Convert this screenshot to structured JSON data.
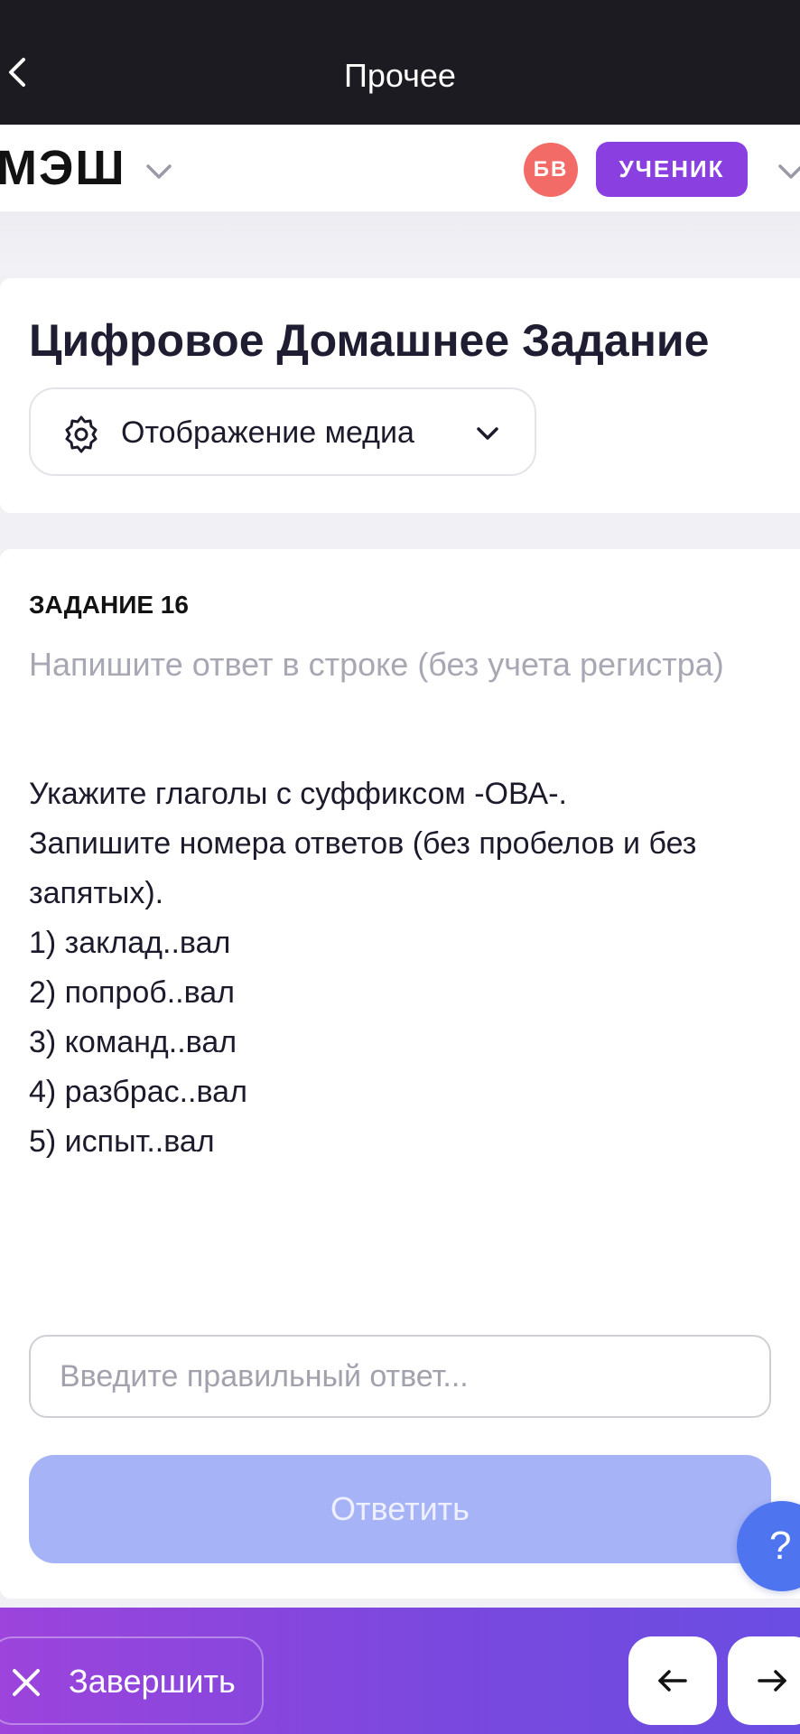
{
  "topbar": {
    "title": "Прочее",
    "back_icon": "chevron-left-icon"
  },
  "header": {
    "logo": "МЭШ",
    "avatar_initials": "БВ",
    "role": "УЧЕНИК",
    "colors": {
      "avatar": "#f36b66",
      "role_badge": "#8a3fe0"
    }
  },
  "page": {
    "title": "Цифровое Домашнее Задание",
    "media_button_label": "Отображение медиа"
  },
  "task": {
    "number_label": "ЗАДАНИЕ 16",
    "instruction": "Напишите ответ в строке (без учета регистра)",
    "question_lines": [
      "Укажите глаголы с суффиксом -ОВА-.",
      "Запишите номера ответов (без пробелов и без",
      "запятых).",
      "1) заклад..вал",
      "2) попроб..вал",
      "3) команд..вал",
      "4) разбрас..вал",
      "5) испыт..вал"
    ],
    "answer_placeholder": "Введите правильный ответ...",
    "answer_value": "",
    "submit_label": "Ответить"
  },
  "help": {
    "label": "?"
  },
  "footer": {
    "finish_label": "Завершить",
    "prev_icon": "arrow-left-icon",
    "next_icon": "arrow-right-icon"
  },
  "colors": {
    "submit_disabled": "#a6b3f7",
    "help": "#4e74f0",
    "footer_gradient_start": "#9c44dc",
    "footer_gradient_end": "#6a4de2"
  }
}
